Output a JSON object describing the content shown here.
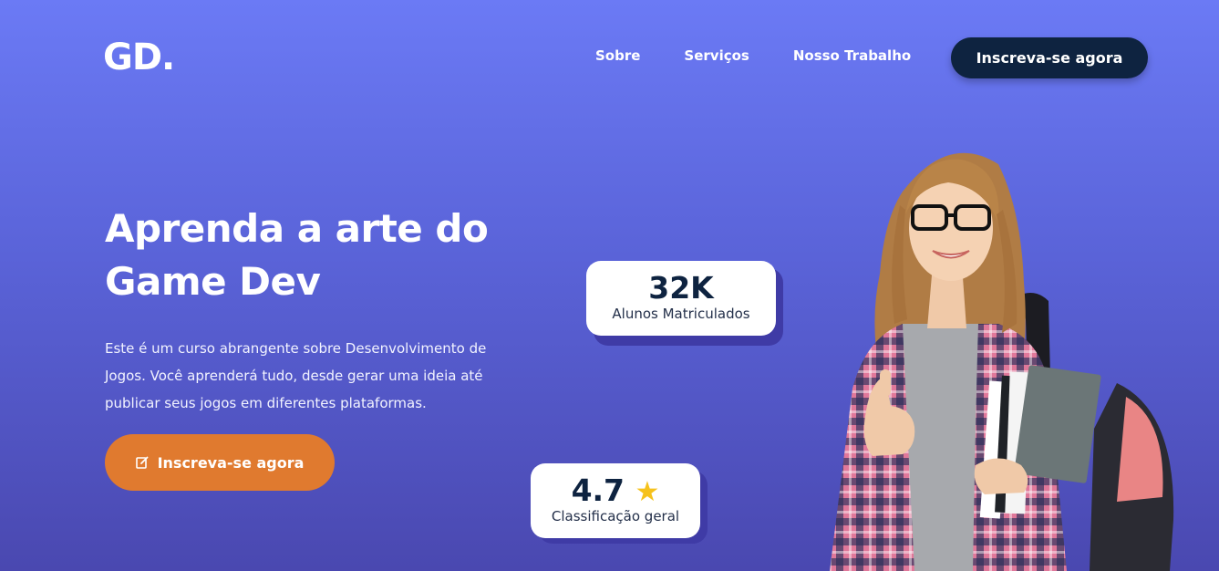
{
  "header": {
    "logo": "GD.",
    "nav": [
      {
        "label": "Sobre"
      },
      {
        "label": "Serviços"
      },
      {
        "label": "Nosso Trabalho"
      }
    ],
    "cta_label": "Inscreva-se agora"
  },
  "hero": {
    "title_line1": "Aprenda a arte do",
    "title_line2": "Game Dev",
    "description": "Este é um curso abrangente sobre Desenvolvimento de Jogos. Você aprenderá tudo, desde gerar uma ideia até publicar seus jogos em diferentes plataformas.",
    "cta_label": "Inscreva-se agora",
    "cta_icon": "edit-icon"
  },
  "stats": {
    "students": {
      "value": "32K",
      "label": "Alunos Matriculados"
    },
    "rating": {
      "value": "4.7",
      "star": "★",
      "label": "Classificação geral"
    }
  },
  "colors": {
    "background_top": "#6b7af5",
    "background_bottom": "#4a48b0",
    "header_cta": "#0e2340",
    "hero_cta": "#e07a2f",
    "star": "#f6c21c"
  }
}
